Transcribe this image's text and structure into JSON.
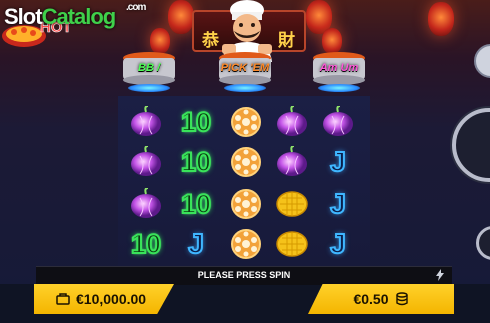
{
  "watermark": {
    "prefix": "Slot",
    "brand": "Catalog",
    "suffix": ".com"
  },
  "sign": {
    "chars": [
      "恭",
      "財"
    ]
  },
  "pots": [
    {
      "label": "BB /",
      "color": "#4dff56"
    },
    {
      "label": "PICK 'EM",
      "color": "#ff8a2a"
    },
    {
      "label": "Am Um",
      "color": "#ff56d8"
    }
  ],
  "reels": {
    "grid": [
      [
        "onion",
        "ten",
        "lotus",
        "onion",
        "onion"
      ],
      [
        "onion",
        "ten",
        "lotus",
        "onion",
        "jay"
      ],
      [
        "onion",
        "ten",
        "lotus",
        "corn",
        "jay"
      ],
      [
        "ten",
        "jay",
        "lotus",
        "corn",
        "jay"
      ]
    ],
    "ten_text": "10",
    "jay_text": "J"
  },
  "message": {
    "text": "PLEASE PRESS SPIN"
  },
  "balance": {
    "value": "€10,000.00"
  },
  "bet": {
    "value": "€0.50"
  },
  "colors": {
    "accent": "#ffd12a",
    "glow_green": "#39e35a",
    "glow_blue": "#3fb6ff"
  }
}
